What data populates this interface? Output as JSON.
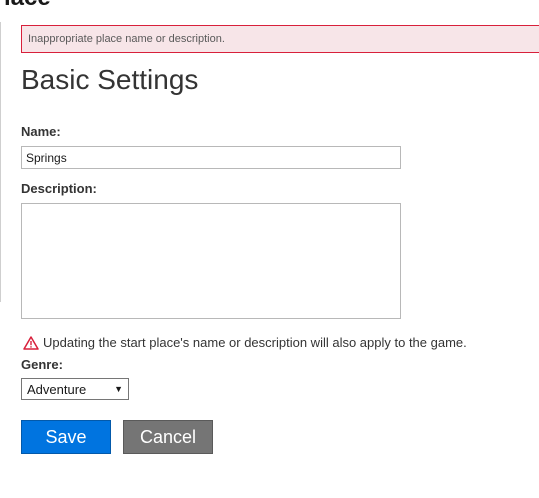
{
  "page": {
    "heading": "lace"
  },
  "error": {
    "message": "Inappropriate place name or description."
  },
  "settings": {
    "title": "Basic Settings",
    "name_label": "Name:",
    "name_value": "Springs",
    "description_label": "Description:",
    "description_value": "",
    "warning_text": "Updating the start place's name or description will also apply to the game.",
    "genre_label": "Genre:",
    "genre_value": "Adventure"
  },
  "buttons": {
    "save": "Save",
    "cancel": "Cancel"
  },
  "colors": {
    "error_border": "#d8203b",
    "error_background": "#f7e5e8",
    "save_button": "#0074e0",
    "cancel_button": "#757575",
    "warning_icon": "#d8203b"
  },
  "icons": {
    "warning": "warning-triangle-icon",
    "dropdown": "caret-down-icon"
  }
}
